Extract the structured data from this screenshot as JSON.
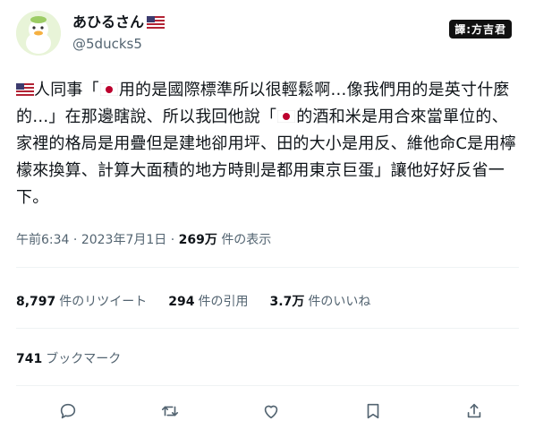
{
  "author": {
    "display_name": "あひるさん",
    "flag": "us-flag-icon",
    "handle": "@5ducks5"
  },
  "watermark": "譯:方吉君",
  "tweet": {
    "p1": "人同事「",
    "p2": "用的是國際標準所以很輕鬆啊…像我們用的是英寸什麼的…」在那邊瞎說、所以我回他說「",
    "p3": "的酒和米是用合來當單位的、家裡的格局是用疊但是建地卻用坪、田的大小是用反、維他命C是用檸檬來換算、計算大面積的地方時則是都用東京巨蛋」讓他好好反省一下。"
  },
  "meta": {
    "time": "午前6:34",
    "separator1": "·",
    "date": "2023年7月1日",
    "separator2": "·",
    "views_count": "269万",
    "views_label": "件の表示"
  },
  "stats": {
    "retweets_count": "8,797",
    "retweets_label": "件のリツイート",
    "quotes_count": "294",
    "quotes_label": "件の引用",
    "likes_count": "3.7万",
    "likes_label": "件のいいね"
  },
  "bookmarks": {
    "count": "741",
    "label": "ブックマーク"
  },
  "colors": {
    "text": "#0f1419",
    "secondary": "#536471",
    "divider": "#eff3f4",
    "jp_red": "#bc002d"
  }
}
